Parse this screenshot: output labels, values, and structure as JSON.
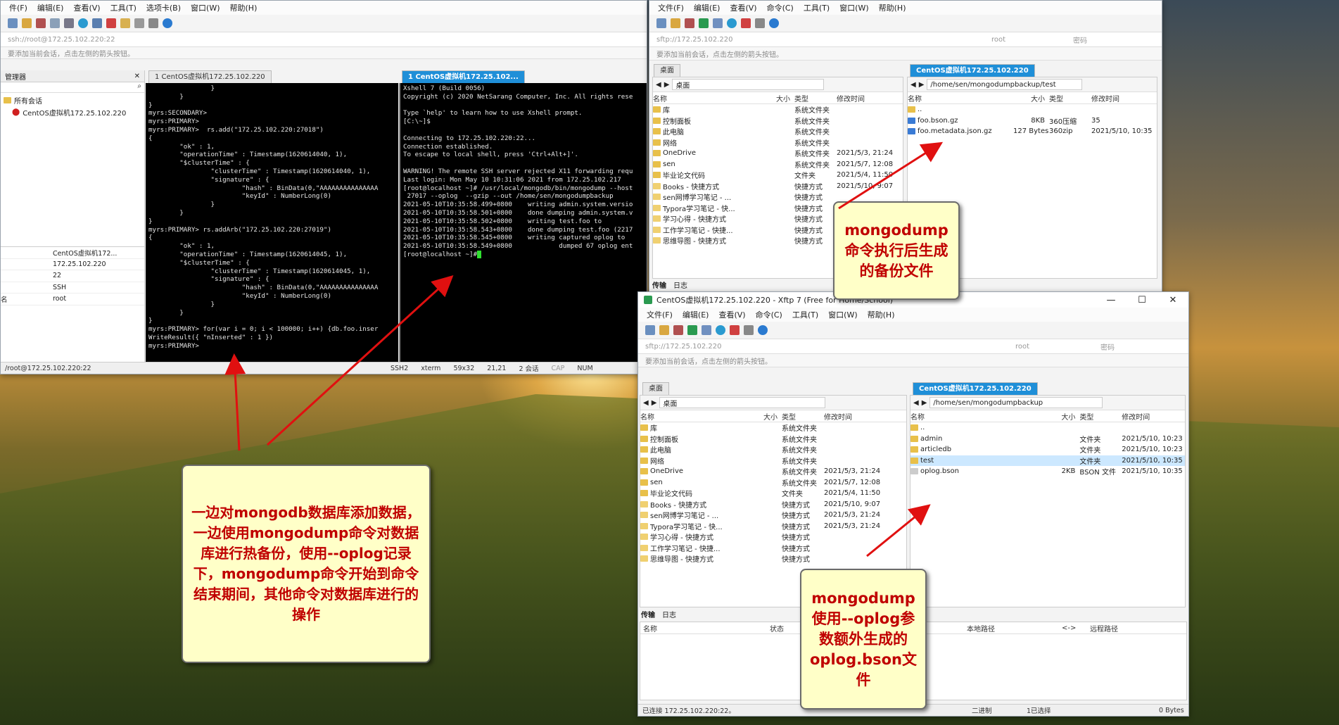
{
  "xshell": {
    "menu": [
      "件(F)",
      "编辑(E)",
      "查看(V)",
      "工具(T)",
      "选项卡(B)",
      "窗口(W)",
      "帮助(H)"
    ],
    "address": "ssh://root@172.25.102.220:22",
    "hint": "要添加当前会话，点击左侧的箭头按钮。",
    "session_panel_title": "管理器",
    "sessions_root": "所有会话",
    "session_item": "CentOS虚拟机172.25.102.220",
    "props": [
      "CentOS虚拟机172...",
      "172.25.102.220",
      "22",
      "SSH",
      "root"
    ],
    "props_label_name": "名",
    "tab1": "1 CentOS虚拟机172.25.102.220",
    "tab2": "1 CentOS虚拟机172.25.102...",
    "left_terminal": "                }\n        }\n}\nmyrs:SECONDARY>\nmyrs:PRIMARY>\nmyrs:PRIMARY>  rs.add(\"172.25.102.220:27018\")\n{\n        \"ok\" : 1,\n        \"operationTime\" : Timestamp(1620614040, 1),\n        \"$clusterTime\" : {\n                \"clusterTime\" : Timestamp(1620614040, 1),\n                \"signature\" : {\n                        \"hash\" : BinData(0,\"AAAAAAAAAAAAAAA\n                        \"keyId\" : NumberLong(0)\n                }\n        }\n}\nmyrs:PRIMARY> rs.addArb(\"172.25.102.220:27019\")\n{\n        \"ok\" : 1,\n        \"operationTime\" : Timestamp(1620614045, 1),\n        \"$clusterTime\" : {\n                \"clusterTime\" : Timestamp(1620614045, 1),\n                \"signature\" : {\n                        \"hash\" : BinData(0,\"AAAAAAAAAAAAAAA\n                        \"keyId\" : NumberLong(0)\n                }\n        }\n}\nmyrs:PRIMARY> for(var i = 0; i < 100000; i++) {db.foo.inser\nWriteResult({ \"nInserted\" : 1 })\nmyrs:PRIMARY>",
    "right_terminal": "Xshell 7 (Build 0056)\nCopyright (c) 2020 NetSarang Computer, Inc. All rights rese\n\nType `help' to learn how to use Xshell prompt.\n[C:\\~]$\n\nConnecting to 172.25.102.220:22...\nConnection established.\nTo escape to local shell, press 'Ctrl+Alt+]'.\n\nWARNING! The remote SSH server rejected X11 forwarding requ\nLast login: Mon May 10 10:31:06 2021 from 172.25.102.217\n[root@localhost ~]# /usr/local/mongodb/bin/mongodump --host\n 27017 --oplog  --gzip --out /home/sen/mongodumpbackup\n2021-05-10T10:35:58.499+0800    writing admin.system.versio\n2021-05-10T10:35:58.501+0800    done dumping admin.system.v\n2021-05-10T10:35:58.502+0800    writing test.foo to\n2021-05-10T10:35:58.543+0800    done dumping test.foo (2217\n2021-05-10T10:35:58.545+0800    writing captured oplog to\n2021-05-10T10:35:58.549+0800            dumped 67 oplog ent\n[root@localhost ~]#",
    "status": [
      "/root@172.25.102.220:22",
      "SSH2",
      "xterm",
      "59x32",
      "21,21",
      "2 会话",
      "CAP",
      "NUM"
    ]
  },
  "xftp_top": {
    "menu": [
      "文件(F)",
      "编辑(E)",
      "查看(V)",
      "命令(C)",
      "工具(T)",
      "窗口(W)",
      "帮助(H)"
    ],
    "address": "sftp://172.25.102.220",
    "user_placeholder": "root",
    "pass_placeholder": "密码",
    "hint": "要添加当前会话，点击左侧的箭头按钮。",
    "left_tab": "桌面",
    "right_tab": "CentOS虚拟机172.25.102.220",
    "left_path": "桌面",
    "right_path": "/home/sen/mongodumpbackup/test",
    "col_headers": [
      "名称",
      "大小",
      "类型",
      "修改时间"
    ],
    "left_files": [
      [
        "库",
        "",
        "系统文件夹",
        ""
      ],
      [
        "控制面板",
        "",
        "系统文件夹",
        ""
      ],
      [
        "此电脑",
        "",
        "系统文件夹",
        ""
      ],
      [
        "网络",
        "",
        "系统文件夹",
        ""
      ],
      [
        "OneDrive",
        "",
        "系统文件夹",
        "2021/5/3, 21:24"
      ],
      [
        "sen",
        "",
        "系统文件夹",
        "2021/5/7, 12:08"
      ],
      [
        "毕业论文代码",
        "",
        "文件夹",
        "2021/5/4, 11:50"
      ],
      [
        "Books - 快捷方式",
        "",
        "快捷方式",
        "2021/5/10, 9:07"
      ],
      [
        "sen网博学习笔记 - ...",
        "",
        "快捷方式",
        ""
      ],
      [
        "Typora学习笔记 - 快...",
        "",
        "快捷方式",
        ""
      ],
      [
        "学习心得 - 快捷方式",
        "",
        "快捷方式",
        ""
      ],
      [
        "工作学习笔记 - 快捷...",
        "",
        "快捷方式",
        ""
      ],
      [
        "思维导图 - 快捷方式",
        "",
        "快捷方式",
        ""
      ]
    ],
    "right_files": [
      [
        "..",
        "",
        "",
        ""
      ],
      [
        "foo.bson.gz",
        "8KB",
        "360压缩",
        "35"
      ],
      [
        "foo.metadata.json.gz",
        "127 Bytes",
        "360zip",
        "2021/5/10, 10:35"
      ]
    ],
    "bottom_tabs": [
      "传输",
      "日志"
    ]
  },
  "xftp_bottom": {
    "title": "CentOS虚拟机172.25.102.220 - Xftp 7 (Free for Home/School)",
    "menu": [
      "文件(F)",
      "编辑(E)",
      "查看(V)",
      "命令(C)",
      "工具(T)",
      "窗口(W)",
      "帮助(H)"
    ],
    "address": "sftp://172.25.102.220",
    "user_placeholder": "root",
    "pass_placeholder": "密码",
    "hint": "要添加当前会话，点击左侧的箭头按钮。",
    "left_tab": "桌面",
    "right_tab": "CentOS虚拟机172.25.102.220",
    "left_path": "桌面",
    "right_path": "/home/sen/mongodumpbackup",
    "col_headers": [
      "名称",
      "大小",
      "类型",
      "修改时间"
    ],
    "left_files": [
      [
        "库",
        "",
        "系统文件夹",
        ""
      ],
      [
        "控制面板",
        "",
        "系统文件夹",
        ""
      ],
      [
        "此电脑",
        "",
        "系统文件夹",
        ""
      ],
      [
        "网络",
        "",
        "系统文件夹",
        ""
      ],
      [
        "OneDrive",
        "",
        "系统文件夹",
        "2021/5/3, 21:24"
      ],
      [
        "sen",
        "",
        "系统文件夹",
        "2021/5/7, 12:08"
      ],
      [
        "毕业论文代码",
        "",
        "文件夹",
        "2021/5/4, 11:50"
      ],
      [
        "Books - 快捷方式",
        "",
        "快捷方式",
        "2021/5/10, 9:07"
      ],
      [
        "sen网博学习笔记 - ...",
        "",
        "快捷方式",
        "2021/5/3, 21:24"
      ],
      [
        "Typora学习笔记 - 快...",
        "",
        "快捷方式",
        "2021/5/3, 21:24"
      ],
      [
        "学习心得 - 快捷方式",
        "",
        "快捷方式",
        ""
      ],
      [
        "工作学习笔记 - 快捷...",
        "",
        "快捷方式",
        ""
      ],
      [
        "思维导图 - 快捷方式",
        "",
        "快捷方式",
        ""
      ]
    ],
    "right_files": [
      [
        "..",
        "",
        "",
        ""
      ],
      [
        "admin",
        "",
        "文件夹",
        "2021/5/10, 10:23"
      ],
      [
        "articledb",
        "",
        "文件夹",
        "2021/5/10, 10:23"
      ],
      [
        "test",
        "",
        "文件夹",
        "2021/5/10, 10:35"
      ],
      [
        "oplog.bson",
        "2KB",
        "BSON 文件",
        "2021/5/10, 10:35"
      ]
    ],
    "bottom_tabs": [
      "传输",
      "日志"
    ],
    "xfer_headers": [
      "名称",
      "状态",
      "本地路径",
      "<->",
      "远程路径"
    ],
    "status": [
      "已连接 172.25.102.220:22。",
      "二进制",
      "1已选择",
      "0 Bytes"
    ]
  },
  "callouts": {
    "main": "一边对mongodb数据库添加数据，一边使用mongodump命令对数据库进行热备份，使用--oplog记录下，mongodump命令开始到命令结束期间，其他命令对数据库进行的操作",
    "top": "mongodump命令执行后生成的备份文件",
    "bottom": "mongodump使用--oplog参数额外生成的oplog.bson文件"
  },
  "colors": {
    "accent_blue": "#1f8fd8",
    "callout_bg": "#ffffc8",
    "callout_text": "#c00000",
    "arrow_red": "#e01010"
  }
}
